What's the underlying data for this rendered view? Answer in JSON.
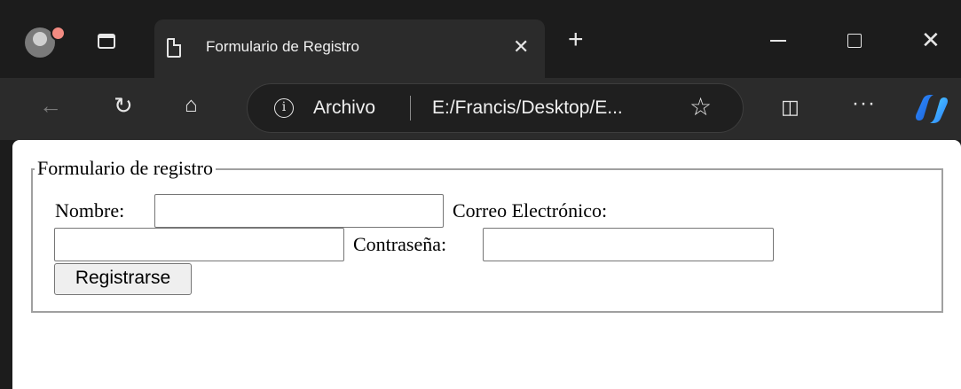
{
  "browser": {
    "tab": {
      "title": "Formulario de Registro",
      "close": "✕"
    },
    "new_tab": "+",
    "window": {
      "close": "✕"
    },
    "toolbar": {
      "back": "←",
      "reload": "↻",
      "home": "⌂",
      "address": {
        "info": "i",
        "label": "Archivo",
        "url": "E:/Francis/Desktop/E..."
      },
      "favorite": "☆",
      "split": "◫",
      "more": "···"
    }
  },
  "form": {
    "legend": "Formulario de registro",
    "nombre_label": "Nombre:",
    "correo_label": "Correo Electrónico:",
    "password_label": "Contraseña:",
    "nombre_value": "",
    "correo_value": "",
    "password_value": "",
    "submit_label": "Registrarse"
  }
}
